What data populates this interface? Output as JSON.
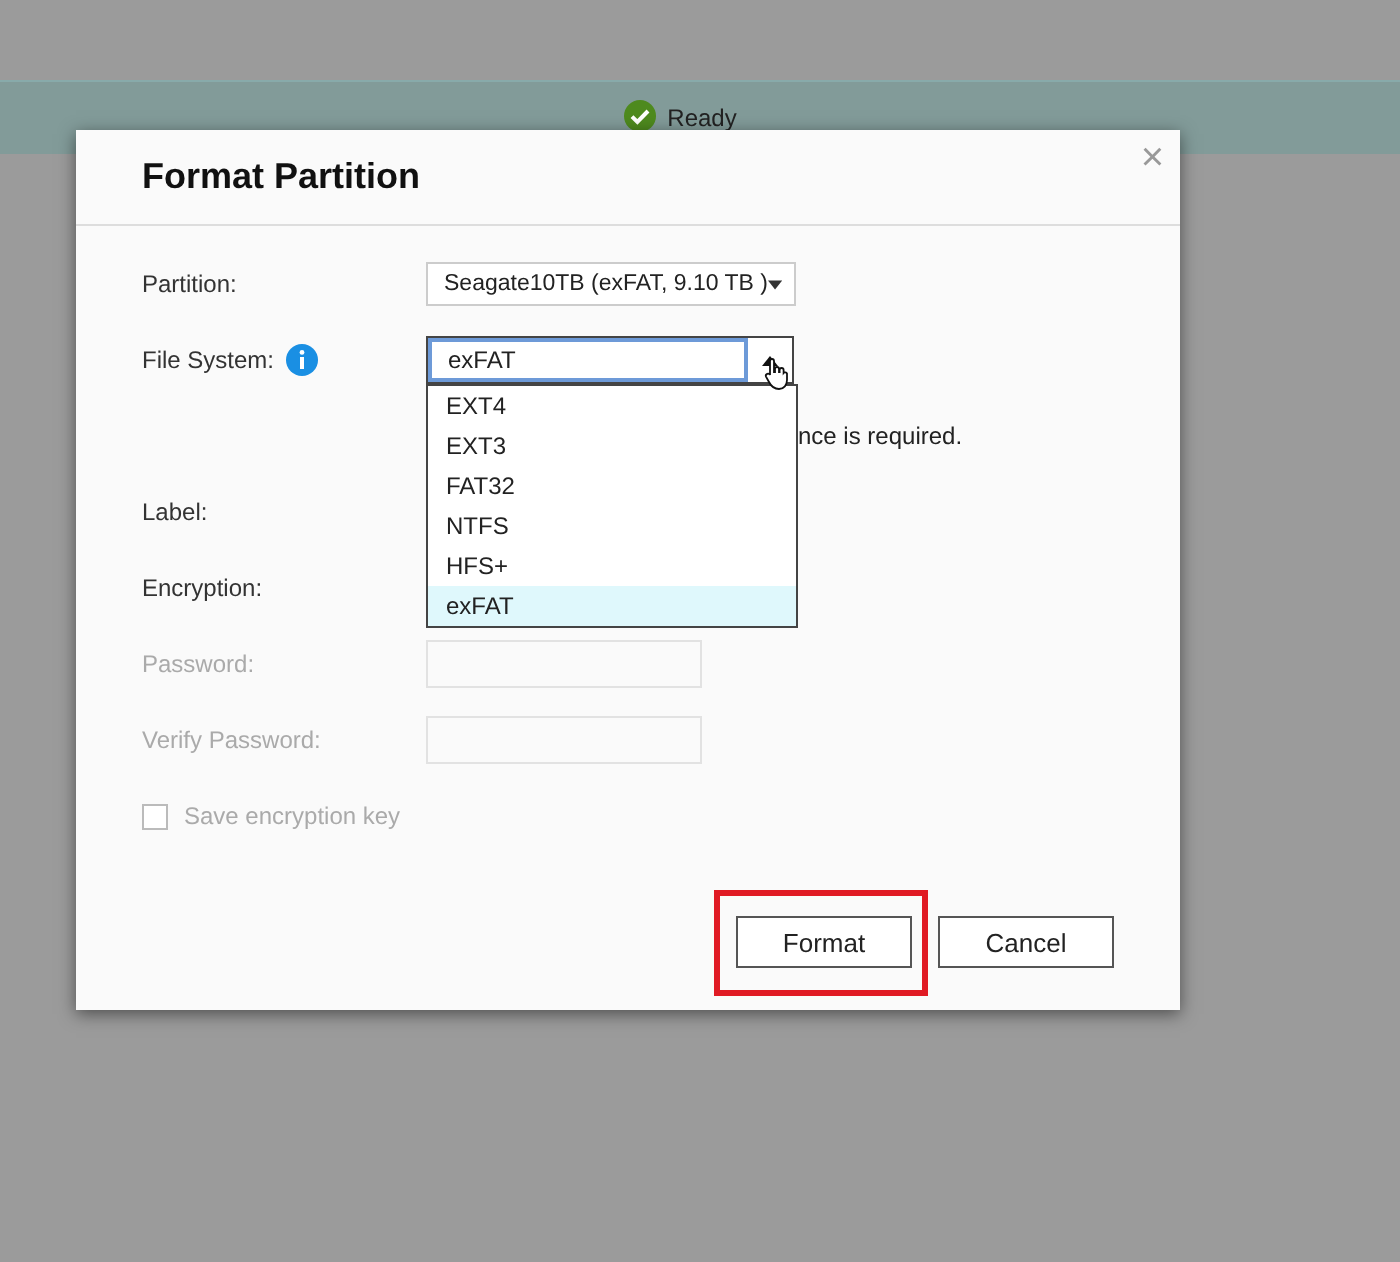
{
  "status_bar": {
    "text": "Ready"
  },
  "dialog": {
    "title": "Format Partition",
    "close_icon": "×",
    "fields": [
      {
        "kind": "select",
        "label": "Partition:",
        "value": "Seagate10TB (exFAT, 9.10 TB )",
        "disabled": false
      },
      {
        "kind": "open-select",
        "label": "File System:",
        "info": true,
        "value": "exFAT",
        "disabled": false,
        "options": [
          {
            "label": "EXT4",
            "selected": false
          },
          {
            "label": "EXT3",
            "selected": false
          },
          {
            "label": "FAT32",
            "selected": false
          },
          {
            "label": "NTFS",
            "selected": false
          },
          {
            "label": "HFS+",
            "selected": false
          },
          {
            "label": "exFAT",
            "selected": true
          }
        ]
      },
      {
        "kind": "note",
        "text": "nce is required."
      },
      {
        "kind": "label",
        "label": "Label:",
        "disabled": false
      },
      {
        "kind": "label",
        "label": "Encryption:",
        "disabled": false
      },
      {
        "kind": "input",
        "label": "Password:",
        "disabled": true
      },
      {
        "kind": "input",
        "label": "Verify Password:",
        "disabled": true
      },
      {
        "kind": "checkbox",
        "label": "Save encryption key",
        "checked": false,
        "disabled": true
      }
    ],
    "buttons": [
      {
        "label": "Format",
        "highlighted": true
      },
      {
        "label": "Cancel",
        "highlighted": false
      }
    ]
  }
}
